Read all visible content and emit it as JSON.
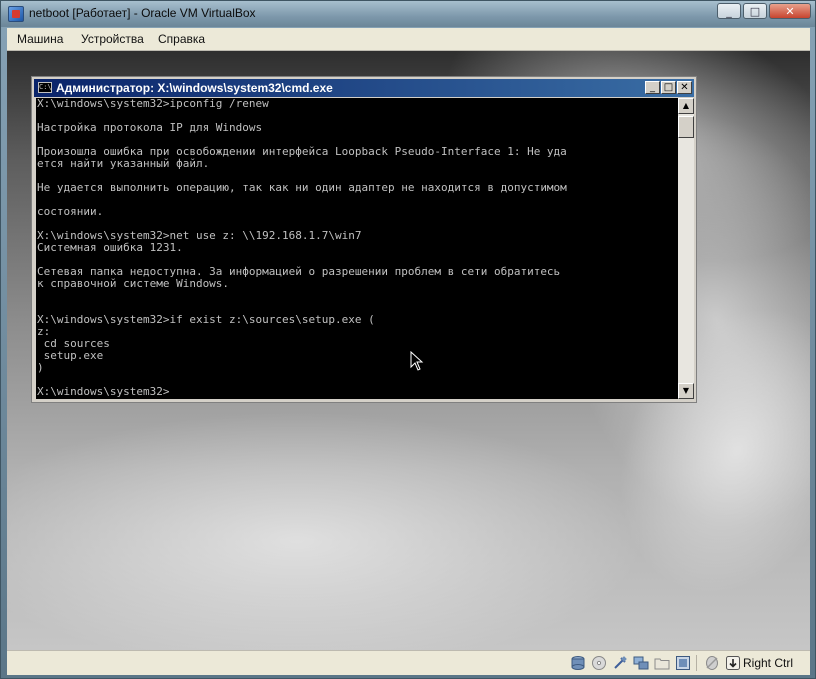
{
  "window": {
    "title": "netboot [Работает] - Oracle VM VirtualBox"
  },
  "menu": {
    "items": [
      "Машина",
      "Устройства",
      "Справка"
    ]
  },
  "cmd": {
    "title": "Администратор: X:\\windows\\system32\\cmd.exe",
    "lines": [
      "X:\\windows\\system32>ipconfig /renew",
      "",
      "Настройка протокола IP для Windows",
      "",
      "Произошла ошибка при освобождении интерфейса Loopback Pseudo-Interface 1: Не уда",
      "ется найти указанный файл.",
      "",
      "Не удается выполнить операцию, так как ни один адаптер не находится в допустимом",
      "",
      "состоянии.",
      "",
      "X:\\windows\\system32>net use z: \\\\192.168.1.7\\win7",
      "Системная ошибка 1231.",
      "",
      "Сетевая папка недоступна. За информацией о разрешении проблем в сети обратитесь",
      "к справочной системе Windows.",
      "",
      "",
      "X:\\windows\\system32>if exist z:\\sources\\setup.exe (",
      "z:",
      " cd sources",
      " setup.exe",
      ")",
      "",
      "X:\\windows\\system32>"
    ]
  },
  "statusbar": {
    "host_key": "Right Ctrl",
    "icons": [
      "hard-disk-icon",
      "optical-drive-icon",
      "usb-icon",
      "network-icon",
      "shared-folders-icon",
      "display-icon",
      "mouse-integration-icon",
      "host-key-icon"
    ]
  }
}
